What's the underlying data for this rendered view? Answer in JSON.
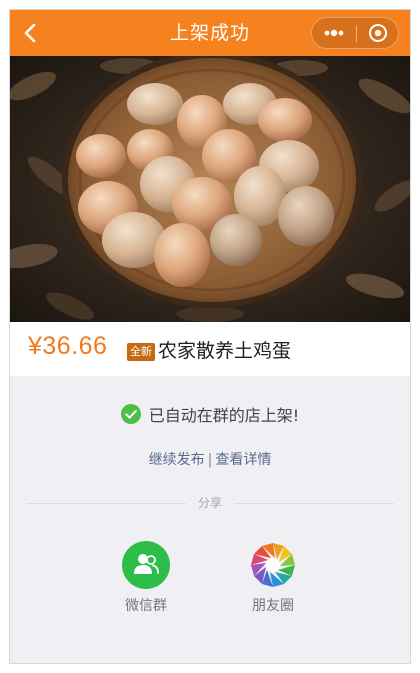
{
  "navbar": {
    "title": "上架成功",
    "back_icon": "chevron-left-icon",
    "more_icon": "more-dots-icon",
    "close_icon": "target-circle-icon",
    "background_color": "#f5811f"
  },
  "product": {
    "image_icon": "eggs-in-basket-photo",
    "price": "¥36.66",
    "condition_badge": "全新",
    "name": "农家散养土鸡蛋",
    "price_color": "#f07a1e"
  },
  "status": {
    "icon": "check-circle-icon",
    "message": "已自动在群的店上架!",
    "success_color": "#4cbf46"
  },
  "actions": {
    "continue_label": "继续发布",
    "separator": "|",
    "details_label": "查看详情"
  },
  "share": {
    "section_label": "分享",
    "targets": [
      {
        "label": "微信群",
        "icon": "wechat-group-icon",
        "color": "#2dbd49"
      },
      {
        "label": "朋友圈",
        "icon": "moments-aperture-icon",
        "color": "#f0a01c"
      }
    ]
  }
}
